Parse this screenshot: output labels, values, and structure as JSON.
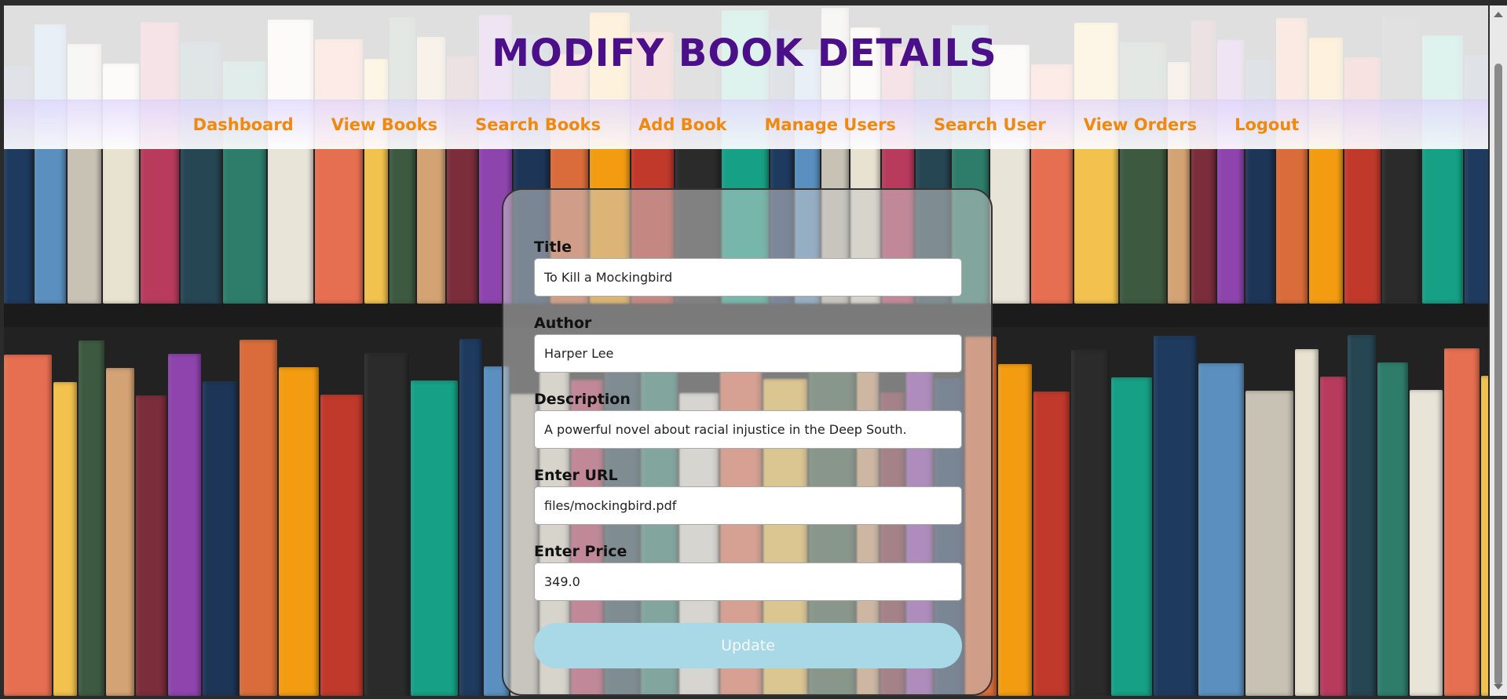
{
  "header": {
    "title": "MODIFY BOOK DETAILS"
  },
  "nav": {
    "items": [
      {
        "label": "Dashboard"
      },
      {
        "label": "View Books"
      },
      {
        "label": "Search Books"
      },
      {
        "label": "Add Book"
      },
      {
        "label": "Manage Users"
      },
      {
        "label": "Search User"
      },
      {
        "label": "View Orders"
      },
      {
        "label": "Logout"
      }
    ]
  },
  "form": {
    "title": {
      "label": "Title",
      "value": "To Kill a Mockingbird"
    },
    "author": {
      "label": "Author",
      "value": "Harper Lee"
    },
    "description": {
      "label": "Description",
      "value": "A powerful novel about racial injustice in the Deep South."
    },
    "url": {
      "label": "Enter URL",
      "value": "files/mockingbird.pdf"
    },
    "price": {
      "label": "Enter Price",
      "value": "349.0"
    },
    "submit_label": "Update"
  },
  "colors": {
    "title": "#4b0f8a",
    "nav_link": "#f0890c",
    "button": "#a9d8e6"
  }
}
